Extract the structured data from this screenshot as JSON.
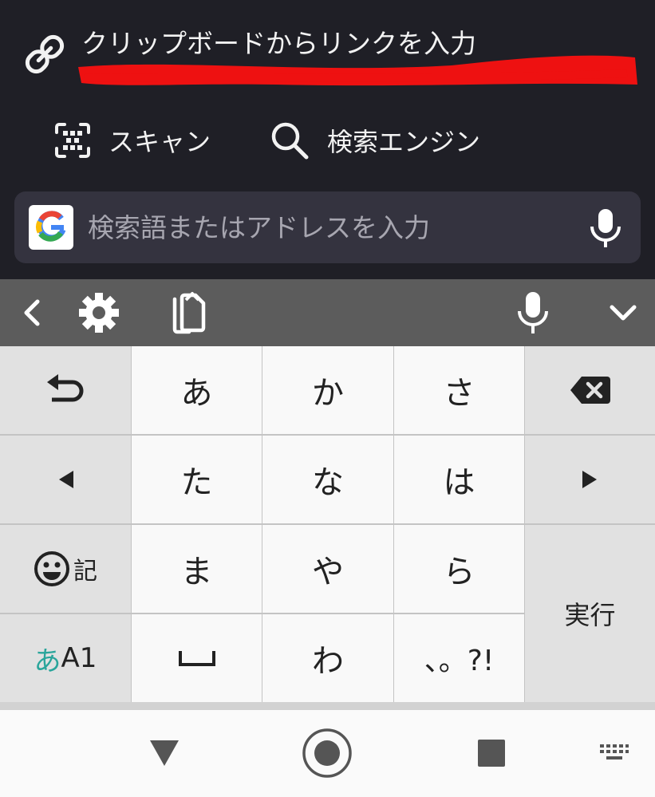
{
  "browser": {
    "clipboard_label": "クリップボードからリンクを入力",
    "scan_label": "スキャン",
    "search_engine_label": "検索エンジン",
    "search": {
      "placeholder": "検索語またはアドレスを入力"
    },
    "icons": [
      "link-icon",
      "qr-scan-icon",
      "search-icon",
      "google-logo",
      "microphone-icon"
    ],
    "colors": {
      "background": "#1f1f26",
      "omnibox": "#34333f",
      "redaction": "#ee1111"
    }
  },
  "toolbar": {
    "icons": [
      "chevron-left-icon",
      "gear-icon",
      "clipboard-icon",
      "microphone-icon",
      "chevron-down-icon"
    ],
    "background": "#5c5c5c"
  },
  "keyboard": {
    "row1": {
      "k1": "あ",
      "k2": "か",
      "k3": "さ"
    },
    "row2": {
      "k1": "た",
      "k2": "な",
      "k3": "は"
    },
    "row3": {
      "k1": "ま",
      "k2": "や",
      "k3": "ら"
    },
    "row4": {
      "k2": "わ",
      "k3": "、。?!"
    },
    "emoji_kigou_label": "記",
    "enter_label": "実行",
    "mode_kana": "あ",
    "mode_alnum": "A1",
    "space_glyph": "␣",
    "accent": "#2aa59b"
  },
  "navbar": {
    "icons": [
      "back-triangle-icon",
      "home-circle-icon",
      "recents-square-icon",
      "keyboard-switch-icon"
    ]
  }
}
